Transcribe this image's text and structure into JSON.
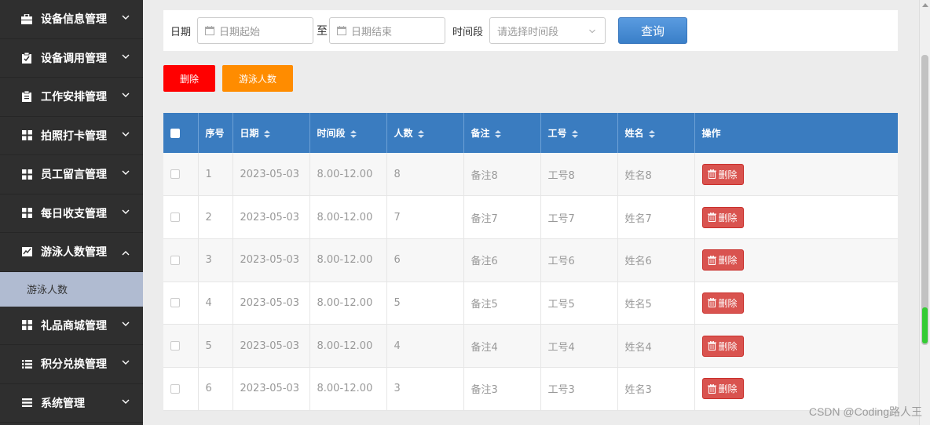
{
  "sidebar": {
    "items": [
      {
        "label": "设备信息管理",
        "icon": "briefcase-icon"
      },
      {
        "label": "设备调用管理",
        "icon": "clipboard-check-icon"
      },
      {
        "label": "工作安排管理",
        "icon": "clipboard-icon"
      },
      {
        "label": "拍照打卡管理",
        "icon": "grid-icon"
      },
      {
        "label": "员工留言管理",
        "icon": "grid-icon"
      },
      {
        "label": "每日收支管理",
        "icon": "grid-icon"
      },
      {
        "label": "游泳人数管理",
        "icon": "line-chart-icon",
        "expanded": true
      },
      {
        "label": "礼品商城管理",
        "icon": "grid-icon"
      },
      {
        "label": "积分兑换管理",
        "icon": "list-icon"
      },
      {
        "label": "系统管理",
        "icon": "bars-icon"
      }
    ],
    "sub_item": "游泳人数"
  },
  "filter": {
    "date_label": "日期",
    "start_placeholder": "日期起始",
    "to_label": "至",
    "end_placeholder": "日期结束",
    "period_label": "时间段",
    "period_placeholder": "请选择时间段",
    "query_button": "查询"
  },
  "actions": {
    "delete_label": "删除",
    "swim_label": "游泳人数"
  },
  "table": {
    "headers": [
      "序号",
      "日期",
      "时间段",
      "人数",
      "备注",
      "工号",
      "姓名",
      "操作"
    ],
    "rows": [
      {
        "no": "1",
        "date": "2023-05-03",
        "period": "8.00-12.00",
        "count": "8",
        "note": "备注8",
        "job": "工号8",
        "name": "姓名8"
      },
      {
        "no": "2",
        "date": "2023-05-03",
        "period": "8.00-12.00",
        "count": "7",
        "note": "备注7",
        "job": "工号7",
        "name": "姓名7"
      },
      {
        "no": "3",
        "date": "2023-05-03",
        "period": "8.00-12.00",
        "count": "6",
        "note": "备注6",
        "job": "工号6",
        "name": "姓名6"
      },
      {
        "no": "4",
        "date": "2023-05-03",
        "period": "8.00-12.00",
        "count": "5",
        "note": "备注5",
        "job": "工号5",
        "name": "姓名5"
      },
      {
        "no": "5",
        "date": "2023-05-03",
        "period": "8.00-12.00",
        "count": "4",
        "note": "备注4",
        "job": "工号4",
        "name": "姓名4"
      },
      {
        "no": "6",
        "date": "2023-05-03",
        "period": "8.00-12.00",
        "count": "3",
        "note": "备注3",
        "job": "工号3",
        "name": "姓名3"
      }
    ],
    "row_delete_label": "删除"
  },
  "colors": {
    "sidebar_bg": "#2f2f2f",
    "header_blue": "#3a7cc0",
    "delete_red": "#ff0000",
    "swim_orange": "#ff8c00",
    "row_delete": "#d9534f"
  },
  "watermark": "CSDN @Coding路人王"
}
